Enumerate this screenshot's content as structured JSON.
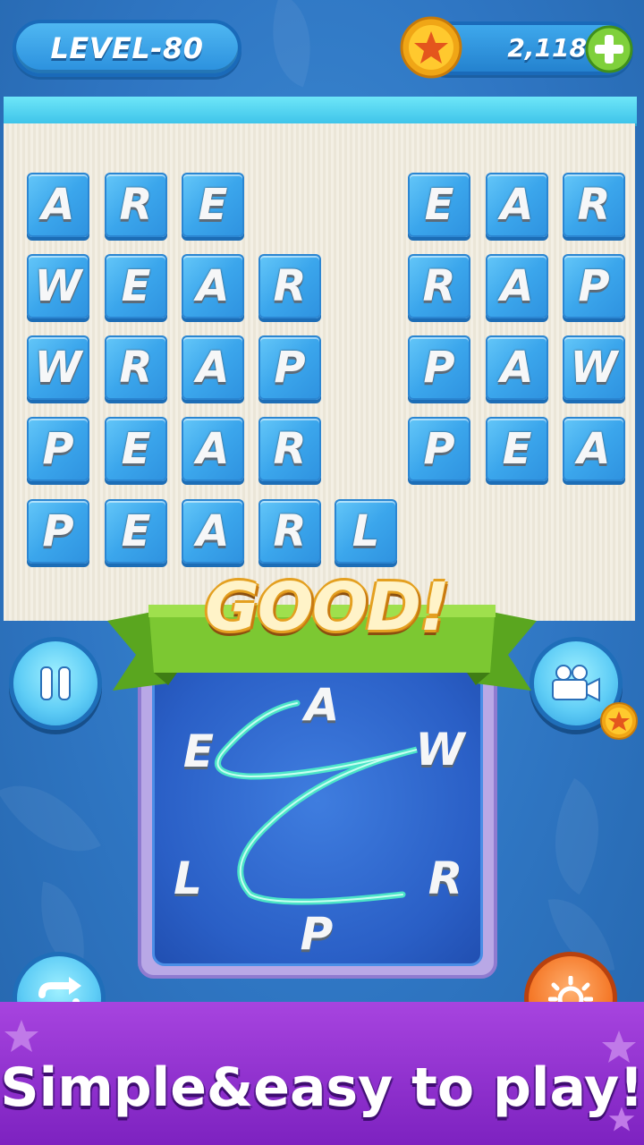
{
  "header": {
    "level_label": "LEVEL-80",
    "coins": "2,118"
  },
  "colors": {
    "background": "#2f76c3",
    "tile": "#3ba6ec",
    "ribbon": "#7cc832",
    "footer": "#9a3bd6",
    "good_text": "#fff3c8"
  },
  "icons": {
    "coin": "star-coin-icon",
    "plus": "plus-icon",
    "pause": "pause-icon",
    "video": "video-camera-icon",
    "shuffle": "shuffle-icon",
    "hint": "lightbulb-icon"
  },
  "board": {
    "left_words": [
      [
        "A",
        "R",
        "E"
      ],
      [
        "W",
        "E",
        "A",
        "R"
      ],
      [
        "W",
        "R",
        "A",
        "P"
      ],
      [
        "P",
        "E",
        "A",
        "R"
      ],
      [
        "P",
        "E",
        "A",
        "R",
        "L"
      ]
    ],
    "right_words": [
      [
        "E",
        "A",
        "R"
      ],
      [
        "R",
        "A",
        "P"
      ],
      [
        "P",
        "A",
        "W"
      ],
      [
        "P",
        "E",
        "A"
      ]
    ]
  },
  "feedback": "GOOD!",
  "wheel": {
    "letters": [
      "A",
      "W",
      "R",
      "P",
      "L",
      "E"
    ]
  },
  "footer": {
    "tagline": "Simple&easy to play!"
  }
}
